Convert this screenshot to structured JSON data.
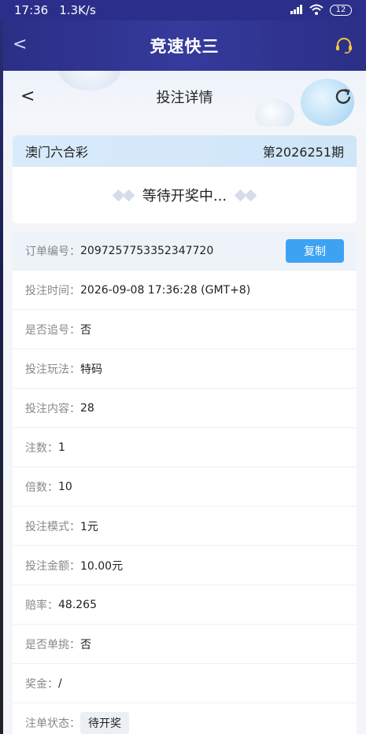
{
  "status_bar": {
    "time": "17:36",
    "speed": "1.3K/s",
    "battery": "12"
  },
  "app_header": {
    "back": "<",
    "title": "竞速快三"
  },
  "sub_header": {
    "back": "<",
    "title": "投注详情"
  },
  "lottery": {
    "name": "澳门六合彩",
    "period": "第2026251期",
    "waiting_text": "等待开奖中..."
  },
  "details": {
    "order_no": {
      "label": "订单编号：",
      "value": "2097257753352347720"
    },
    "copy_label": "复制",
    "rows": [
      {
        "label": "投注时间：",
        "value": "2026-09-08 17:36:28 (GMT+8)"
      },
      {
        "label": "是否追号：",
        "value": "否"
      },
      {
        "label": "投注玩法：",
        "value": "特码"
      },
      {
        "label": "投注内容：",
        "value": "28"
      },
      {
        "label": "注数：",
        "value": "1"
      },
      {
        "label": "倍数：",
        "value": "10"
      },
      {
        "label": "投注模式：",
        "value": "1元"
      },
      {
        "label": "投注金额：",
        "value": "10.00元"
      },
      {
        "label": "赔率：",
        "value": "48.265"
      },
      {
        "label": "是否单挑：",
        "value": "否"
      },
      {
        "label": "奖金：",
        "value": "/"
      }
    ],
    "status": {
      "label": "注单状态：",
      "value": "待开奖"
    }
  }
}
